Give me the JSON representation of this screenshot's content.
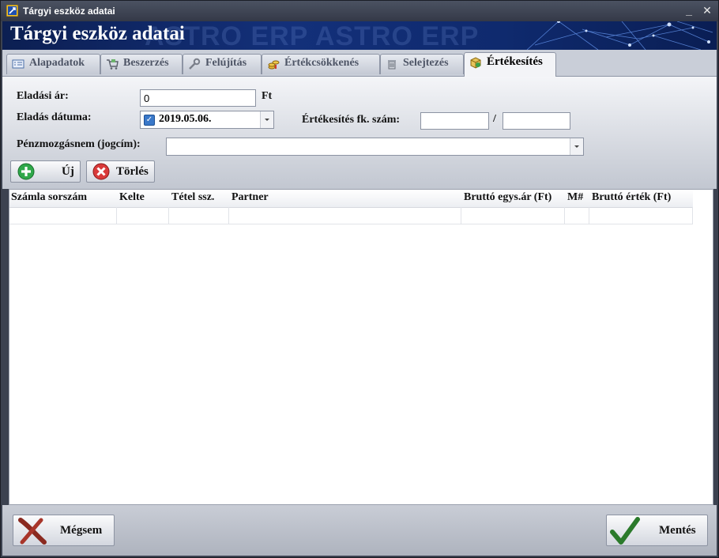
{
  "window": {
    "title": "Tárgyi eszköz adatai",
    "minimize": "_",
    "close": "✕"
  },
  "banner": {
    "heading": "Tárgyi eszköz adatai",
    "watermark": "ASTRO ERP   ASTRO ERP"
  },
  "tabs": [
    {
      "label": "Alapadatok",
      "icon": "list-icon"
    },
    {
      "label": "Beszerzés",
      "icon": "cart-icon"
    },
    {
      "label": "Felújítás",
      "icon": "wrench-icon"
    },
    {
      "label": "Értékcsökkenés",
      "icon": "coins-icon"
    },
    {
      "label": "Selejtezés",
      "icon": "trash-icon"
    },
    {
      "label": "Értékesítés",
      "icon": "box-icon",
      "active": true
    }
  ],
  "form": {
    "price_label": "Eladási ár:",
    "price_value": "0",
    "price_unit": "Ft",
    "date_label": "Eladás dátuma:",
    "date_value": "2019.05.06.",
    "date_checked": true,
    "account_label": "Értékesítés fk. szám:",
    "account_part1": "",
    "account_sep": "/",
    "account_part2": "",
    "cash_label": "Pénzmozgásnem (jogcím):",
    "cash_value": ""
  },
  "actions": {
    "new_label": "Új",
    "delete_label": "Törlés"
  },
  "table": {
    "columns": [
      "Számla sorszám",
      "Kelte",
      "Tétel ssz.",
      "Partner",
      "Bruttó egys.ár (Ft)",
      "M#",
      "Bruttó érték (Ft)"
    ],
    "rows": []
  },
  "footer": {
    "cancel_label": "Mégsem",
    "save_label": "Mentés"
  },
  "colors": {
    "banner": "#13307a",
    "add_icon": "#2fa84a",
    "delete_icon": "#d93a3a",
    "check": "#2b7a2b",
    "cancel_x": "#8a2a20"
  }
}
